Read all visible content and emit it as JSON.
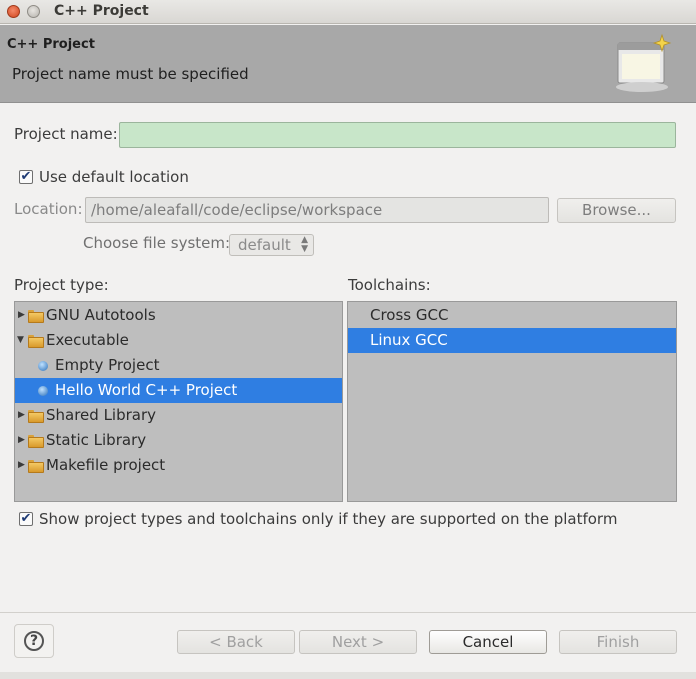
{
  "window": {
    "title": "C++ Project"
  },
  "header": {
    "title": "C++ Project",
    "message": "Project name must be specified"
  },
  "form": {
    "project_name_label": "Project name:",
    "project_name_value": "",
    "use_default_location_label": "Use default location",
    "use_default_location_checked": true,
    "location_label": "Location:",
    "location_value": "/home/aleafall/code/eclipse/workspace",
    "browse_label": "Browse...",
    "file_system_label": "Choose file system:",
    "file_system_value": "default"
  },
  "project_type": {
    "label": "Project type:",
    "items": [
      {
        "label": "GNU Autotools",
        "kind": "folder",
        "expanded": false,
        "selected": false
      },
      {
        "label": "Executable",
        "kind": "folder",
        "expanded": true,
        "selected": false
      },
      {
        "label": "Empty Project",
        "kind": "project",
        "selected": false
      },
      {
        "label": "Hello World C++ Project",
        "kind": "project",
        "selected": true
      },
      {
        "label": "Shared Library",
        "kind": "folder",
        "expanded": false,
        "selected": false
      },
      {
        "label": "Static Library",
        "kind": "folder",
        "expanded": false,
        "selected": false
      },
      {
        "label": "Makefile project",
        "kind": "folder",
        "expanded": false,
        "selected": false
      }
    ]
  },
  "toolchains": {
    "label": "Toolchains:",
    "items": [
      {
        "label": "Cross GCC",
        "selected": false
      },
      {
        "label": "Linux GCC",
        "selected": true
      }
    ]
  },
  "filter": {
    "label": "Show project types and toolchains only if they are supported on the platform",
    "checked": true
  },
  "buttons": {
    "help": "?",
    "back": "< Back",
    "next": "Next >",
    "cancel": "Cancel",
    "finish": "Finish"
  },
  "colors": {
    "selection": "#2f7ee2",
    "header_bg": "#a8a8a8",
    "invalid_field": "#c8e6c9"
  }
}
